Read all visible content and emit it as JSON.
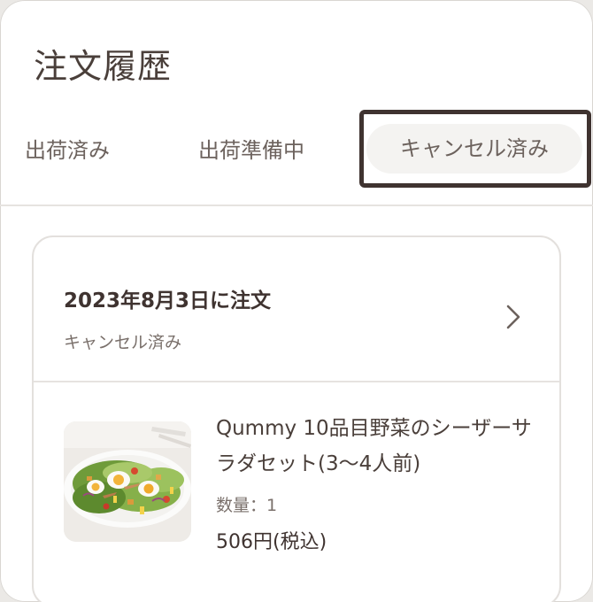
{
  "header": {
    "title": "注文履歴"
  },
  "tabs": [
    {
      "label": "出荷済み",
      "selected": false
    },
    {
      "label": "出荷準備中",
      "selected": false
    },
    {
      "label": "キャンセル済み",
      "selected": true
    }
  ],
  "order": {
    "date_label": "2023年8月3日に注文",
    "status": "キャンセル済み",
    "open_icon": "chevron-right-icon",
    "item": {
      "image_icon": "salad-photo",
      "name": "Qummy 10品目野菜のシーザーサラダセット(3〜4人前)",
      "quantity": "数量：1",
      "price": "506円(税込)"
    }
  },
  "colors": {
    "text_primary": "#4a3f3a",
    "text_secondary": "#7a706b",
    "selected_tab_bg": "#f4f3f1",
    "focus_ring": "#3f3330",
    "divider": "#e6e3e0"
  }
}
